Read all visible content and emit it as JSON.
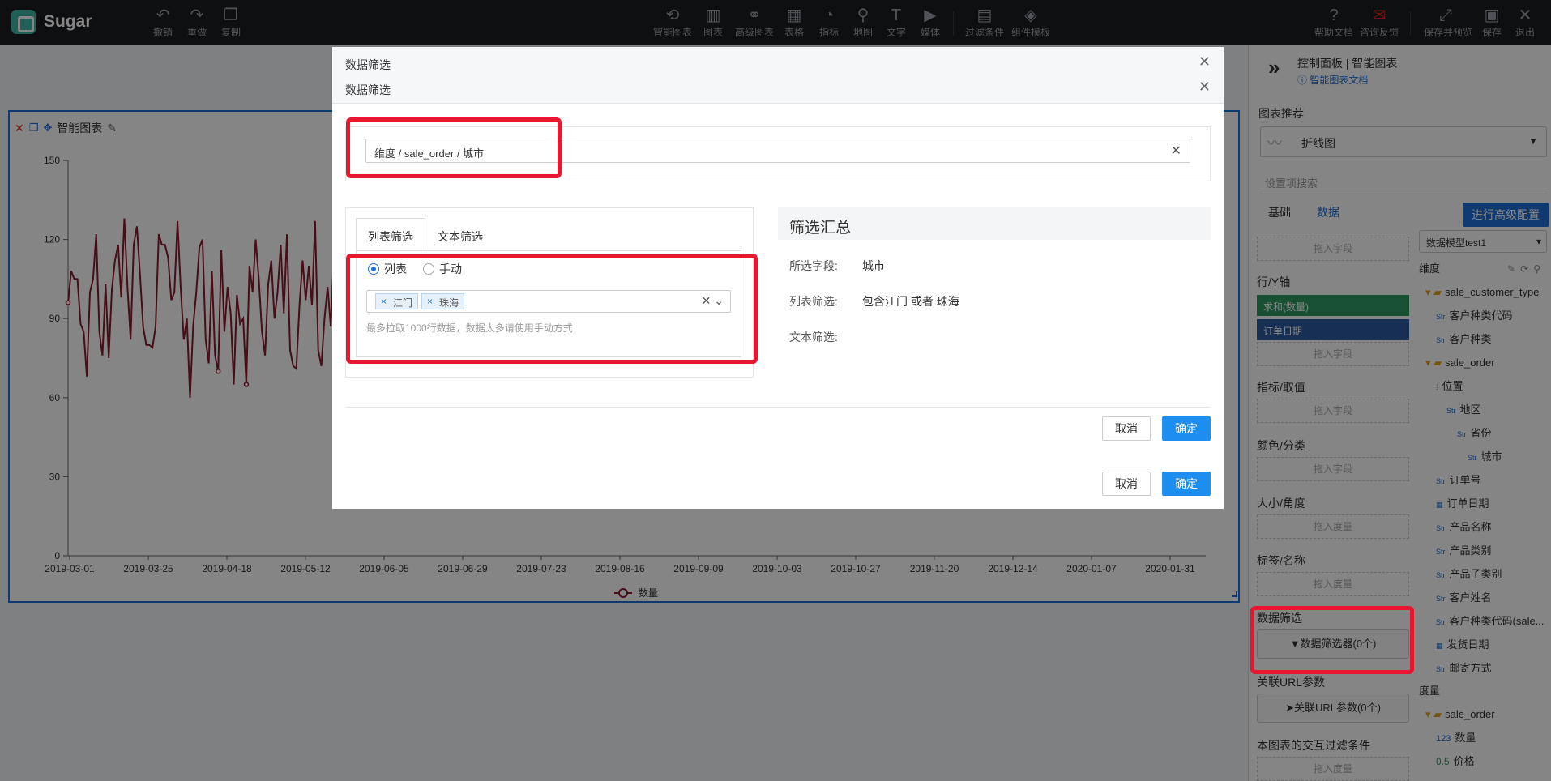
{
  "app": {
    "name": "Sugar"
  },
  "toolbar_left": [
    {
      "label": "撤销",
      "icon": "undo-icon",
      "glyph": "↶"
    },
    {
      "label": "重做",
      "icon": "redo-icon",
      "glyph": "↷"
    },
    {
      "label": "复制",
      "icon": "copy-icon",
      "glyph": "❐"
    }
  ],
  "toolbar_center": [
    {
      "label": "智能图表",
      "icon": "smart-chart-icon",
      "glyph": "⟲"
    },
    {
      "label": "图表",
      "icon": "bar-chart-icon",
      "glyph": "▥"
    },
    {
      "label": "高级图表",
      "icon": "advanced-chart-icon",
      "glyph": "⚭"
    },
    {
      "label": "表格",
      "icon": "table-icon",
      "glyph": "▦"
    },
    {
      "label": "指标",
      "icon": "gauge-icon",
      "glyph": "◔"
    },
    {
      "label": "地图",
      "icon": "map-icon",
      "glyph": "⚲"
    },
    {
      "label": "文字",
      "icon": "text-icon",
      "glyph": "T"
    },
    {
      "label": "媒体",
      "icon": "media-icon",
      "glyph": "▶"
    },
    {
      "label": "过滤条件",
      "icon": "filter-condition-icon",
      "glyph": "▤"
    },
    {
      "label": "组件模板",
      "icon": "template-icon",
      "glyph": "◈"
    }
  ],
  "toolbar_right": [
    {
      "label": "帮助文档",
      "icon": "help-icon",
      "glyph": "?"
    },
    {
      "label": "咨询反馈",
      "icon": "feedback-icon",
      "glyph": "✉"
    },
    {
      "label": "保存并预览",
      "icon": "expand-icon",
      "glyph": "⤢"
    },
    {
      "label": "保存",
      "icon": "save-icon",
      "glyph": "▣"
    },
    {
      "label": "退出",
      "icon": "exit-icon",
      "glyph": "✕"
    }
  ],
  "chart_panel": {
    "title": "智能图表"
  },
  "chart_data": {
    "type": "line",
    "title": "",
    "xlabel": "",
    "ylabel": "",
    "ylim": [
      0,
      150
    ],
    "yticks": [
      0,
      30,
      60,
      90,
      120,
      150
    ],
    "xticks": [
      "2019-03-01",
      "2019-03-25",
      "2019-04-18",
      "2019-05-12",
      "2019-06-05",
      "2019-06-29",
      "2019-07-23",
      "2019-08-16",
      "2019-09-09",
      "2019-10-03",
      "2019-10-27",
      "2019-11-20",
      "2019-12-14",
      "2020-01-07",
      "2020-01-31"
    ],
    "legend": "bottom",
    "series": [
      {
        "name": "数量",
        "color": "#8a1a2b",
        "values": [
          96,
          108,
          105,
          105,
          88,
          85,
          68,
          100,
          105,
          122,
          85,
          76,
          103,
          75,
          101,
          112,
          118,
          98,
          128,
          102,
          82,
          118,
          125,
          107,
          87,
          80,
          80,
          79,
          87,
          122,
          118,
          118,
          113,
          97,
          100,
          127,
          102,
          82,
          90,
          60,
          87,
          100,
          117,
          120,
          82,
          73,
          108,
          76,
          70,
          116,
          85,
          102,
          92,
          65,
          99,
          88,
          90,
          65,
          110,
          100,
          120,
          105,
          85,
          76,
          103,
          112,
          90,
          100,
          118,
          92,
          122,
          78,
          72,
          71,
          95,
          112,
          97,
          110,
          95,
          127,
          78,
          72,
          90,
          102,
          87,
          114
        ]
      }
    ]
  },
  "right_panel": {
    "breadcrumb": "控制面板 | 智能图表",
    "doc_link": "智能图表文档",
    "recommend_label": "图表推荐",
    "recommend_value": "折线图",
    "search_placeholder": "设置项搜索",
    "tab_basic": "基础",
    "tab_data": "数据",
    "advanced_button": "进行高级配置",
    "drop_field": "拖入字段",
    "drop_measure": "拖入度量",
    "row_y_label": "行/Y轴",
    "pill_sum": "求和(数量)",
    "pill_date": "订单日期",
    "metric_label": "指标/取值",
    "color_label": "颜色/分类",
    "size_label": "大小/角度",
    "tag_label": "标签/名称",
    "filter_label": "数据筛选",
    "filter_button": "数据筛选器(0个)",
    "url_label": "关联URL参数",
    "url_button": "关联URL参数(0个)",
    "interact_label": "本图表的交互过滤条件",
    "model_select": "数据模型test1",
    "dimension_label": "维度",
    "tree": [
      {
        "text": "sale_customer_type",
        "kind": "folder",
        "indent": 0
      },
      {
        "text": "客户种类代码",
        "kind": "Str",
        "indent": 1
      },
      {
        "text": "客户种类",
        "kind": "Str",
        "indent": 1
      },
      {
        "text": "sale_order",
        "kind": "folder",
        "indent": 0
      },
      {
        "text": "位置",
        "kind": "geo",
        "indent": 1
      },
      {
        "text": "地区",
        "kind": "Str",
        "indent": 2
      },
      {
        "text": "省份",
        "kind": "Str",
        "indent": 3
      },
      {
        "text": "城市",
        "kind": "Str",
        "indent": 4
      },
      {
        "text": "订单号",
        "kind": "Str",
        "indent": 1
      },
      {
        "text": "订单日期",
        "kind": "date",
        "indent": 1
      },
      {
        "text": "产品名称",
        "kind": "Str",
        "indent": 1
      },
      {
        "text": "产品类别",
        "kind": "Str",
        "indent": 1
      },
      {
        "text": "产品子类别",
        "kind": "Str",
        "indent": 1
      },
      {
        "text": "客户姓名",
        "kind": "Str",
        "indent": 1
      },
      {
        "text": "客户种类代码(sale...",
        "kind": "Str",
        "indent": 1
      },
      {
        "text": "发货日期",
        "kind": "date",
        "indent": 1
      },
      {
        "text": "邮寄方式",
        "kind": "Str",
        "indent": 1
      }
    ],
    "measure_label": "度量",
    "measure_tree": [
      {
        "text": "sale_order",
        "kind": "folder",
        "indent": 0
      },
      {
        "text": "数量",
        "kind": "123",
        "indent": 1
      },
      {
        "text": "价格",
        "kind": "0.5",
        "indent": 1
      }
    ]
  },
  "modal_back": {
    "title": "数据筛选",
    "cancel": "取消",
    "ok": "确定"
  },
  "modal": {
    "title": "数据筛选",
    "field_path": "维度 / sale_order / 城市",
    "tab_list": "列表筛选",
    "tab_text": "文本筛选",
    "radio_list": "列表",
    "radio_manual": "手动",
    "chips": [
      "江门",
      "珠海"
    ],
    "hint": "最多拉取1000行数据，数据太多请使用手动方式",
    "summary_title": "筛选汇总",
    "sum_field_key": "所选字段:",
    "sum_field_val": "城市",
    "sum_list_key": "列表筛选:",
    "sum_list_val": "包含江门 或者 珠海",
    "sum_text_key": "文本筛选:",
    "sum_text_val": "",
    "cancel": "取消",
    "ok": "确定"
  }
}
